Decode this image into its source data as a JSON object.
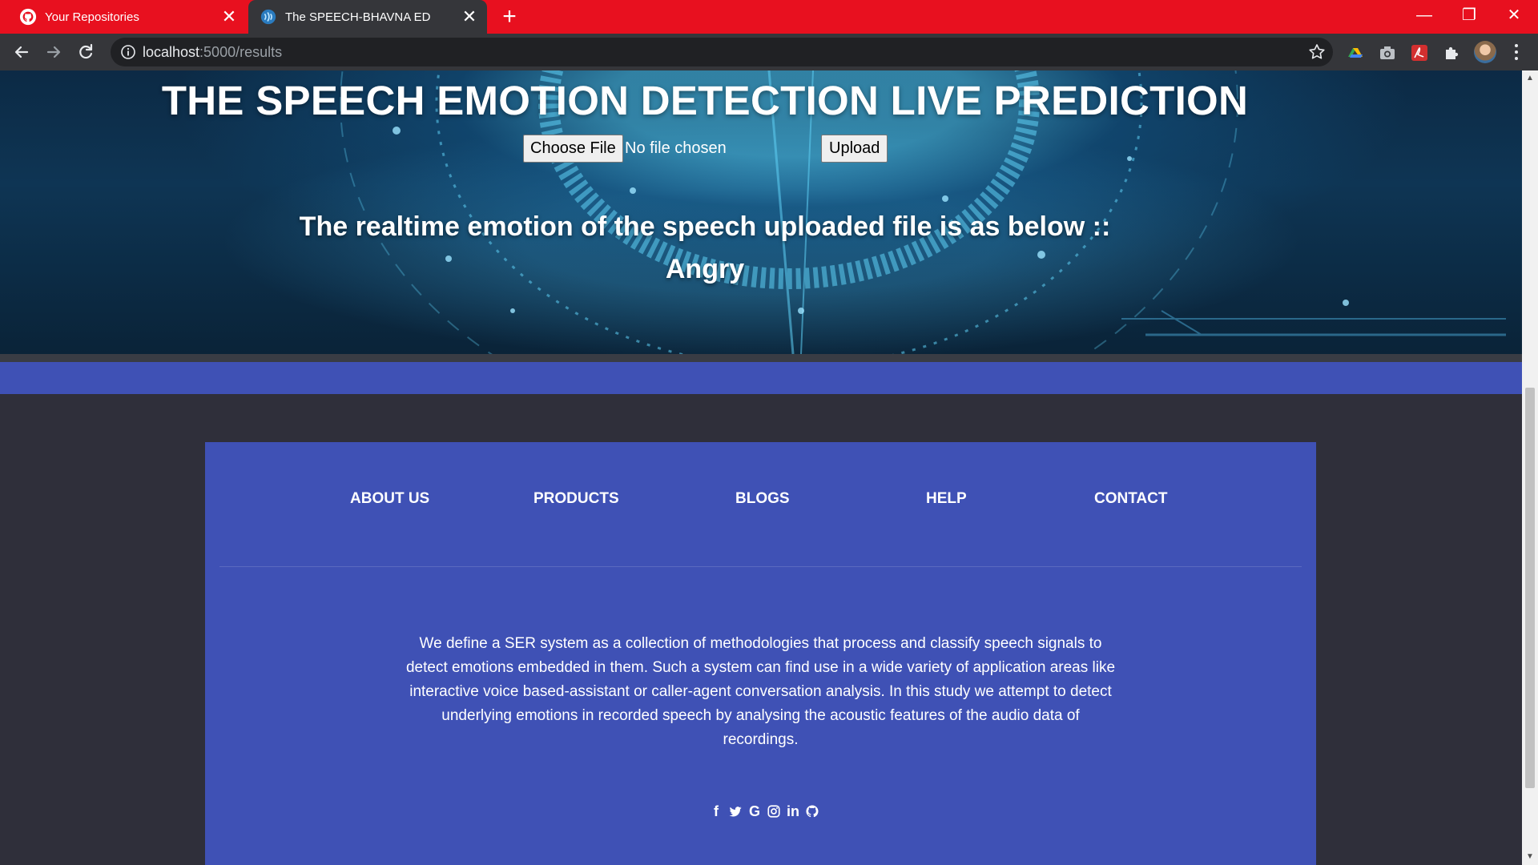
{
  "browser": {
    "tabs": [
      {
        "title": "Your Repositories",
        "favicon": "github-icon",
        "active": false
      },
      {
        "title": "The SPEECH-BHAVNA ED",
        "favicon": "site-favicon",
        "active": true
      }
    ],
    "close_glyph": "✕",
    "new_tab_glyph": "+",
    "url_host": "localhost",
    "url_path": ":5000/results",
    "window_controls": {
      "minimize": "—",
      "restore": "❐",
      "close": "✕"
    }
  },
  "hero": {
    "title": "THE SPEECH EMOTION DETECTION LIVE PREDICTION",
    "choose_file_label": "Choose File",
    "no_file_text": "No file chosen",
    "upload_label": "Upload",
    "result_text": "The realtime emotion of the speech uploaded file is as below ::",
    "emotion": "Angry"
  },
  "footer": {
    "nav": [
      "ABOUT US",
      "PRODUCTS",
      "BLOGS",
      "HELP",
      "CONTACT"
    ],
    "description": "We define a SER system as a collection of methodologies that process and classify speech signals to detect emotions embedded in them. Such a system can find use in a wide variety of application areas like interactive voice based-assistant or caller-agent conversation analysis. In this study we attempt to detect underlying emotions in recorded speech by analysing the acoustic features of the audio data of recordings.",
    "socials": [
      {
        "name": "facebook-icon",
        "glyph": "f"
      },
      {
        "name": "twitter-icon",
        "glyph": "🐦"
      },
      {
        "name": "google-icon",
        "glyph": "G"
      },
      {
        "name": "instagram-icon",
        "glyph": "◎"
      },
      {
        "name": "linkedin-icon",
        "glyph": "in"
      },
      {
        "name": "github-icon",
        "glyph": "⌾"
      }
    ]
  },
  "colors": {
    "tab_strip": "#e8101f",
    "toolbar": "#35363a",
    "footer_blue": "#3f51b5",
    "page_bg": "#2f2f3a"
  }
}
